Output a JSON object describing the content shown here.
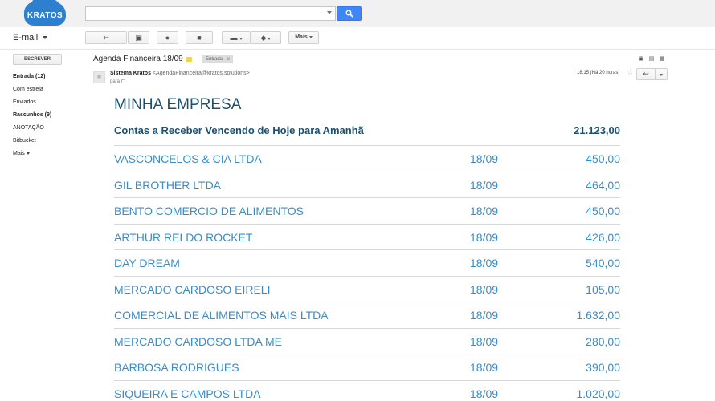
{
  "brand": {
    "logo_text": "KRATOS",
    "accent": "#2f7fcf"
  },
  "search": {
    "value": "",
    "button_icon": "search-icon"
  },
  "toolbar": {
    "section_label": "E-mail",
    "more_label": "Mais",
    "buttons": [
      "back-icon",
      "archive-icon",
      "spam-icon",
      "delete-icon",
      "folder-icon",
      "label-icon"
    ]
  },
  "sidebar": {
    "compose_label": "ESCREVER",
    "items": [
      {
        "label": "Entrada (12)",
        "bold": true
      },
      {
        "label": "Com estrela",
        "bold": false
      },
      {
        "label": "Enviados",
        "bold": false
      },
      {
        "label": "Rascunhos (9)",
        "bold": true
      },
      {
        "label": "ANOTAÇÃO",
        "bold": false
      },
      {
        "label": "Bitbucket",
        "bold": false
      },
      {
        "label": "Mais",
        "bold": false
      }
    ]
  },
  "message": {
    "subject": "Agenda Financeira 18/09",
    "label_chip": "Entrada",
    "label_close": "x",
    "sender_name": "Sistema Kratos",
    "sender_email": "<AgendaFinanceira@kratos.solutions>",
    "to_label": "para",
    "time": "18:15 (Há 20 horas)"
  },
  "email": {
    "company": "MINHA EMPRESA",
    "summary_label": "Contas a Receber Vencendo de Hoje para Amanhã",
    "summary_total": "21.123,00",
    "rows": [
      {
        "name": "VASCONCELOS & CIA LTDA",
        "date": "18/09",
        "amount": "450,00"
      },
      {
        "name": "GIL BROTHER LTDA",
        "date": "18/09",
        "amount": "464,00"
      },
      {
        "name": "BENTO COMERCIO DE ALIMENTOS",
        "date": "18/09",
        "amount": "450,00"
      },
      {
        "name": "ARTHUR REI DO ROCKET",
        "date": "18/09",
        "amount": "426,00"
      },
      {
        "name": "DAY DREAM",
        "date": "18/09",
        "amount": "540,00"
      },
      {
        "name": "MERCADO CARDOSO EIRELI",
        "date": "18/09",
        "amount": "105,00"
      },
      {
        "name": "COMERCIAL DE ALIMENTOS MAIS LTDA",
        "date": "18/09",
        "amount": "1.632,00"
      },
      {
        "name": "MERCADO CARDOSO LTDA ME",
        "date": "18/09",
        "amount": "280,00"
      },
      {
        "name": "BARBOSA RODRIGUES",
        "date": "18/09",
        "amount": "390,00"
      },
      {
        "name": "SIQUEIRA E CAMPOS LTDA",
        "date": "18/09",
        "amount": "1.020,00"
      }
    ]
  }
}
